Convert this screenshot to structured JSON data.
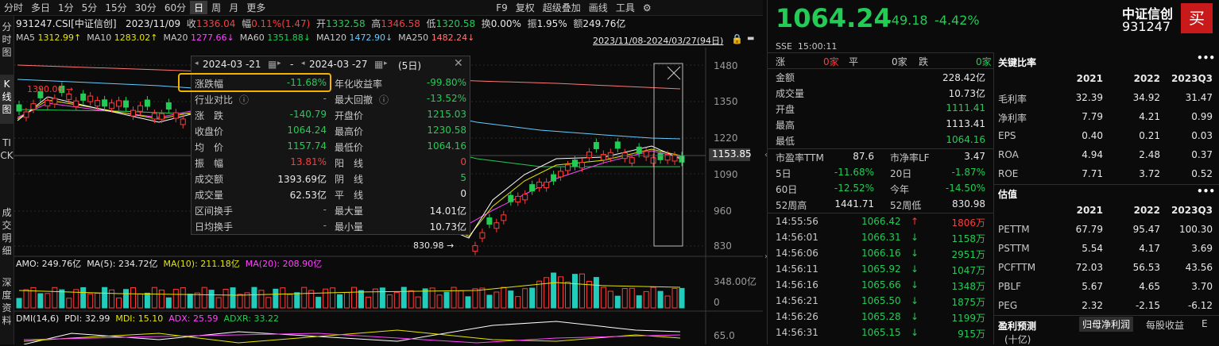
{
  "toolbar": {
    "tabs": [
      "分时",
      "多日",
      "1分",
      "5分",
      "15分",
      "30分",
      "60分",
      "日",
      "周",
      "月",
      "更多"
    ],
    "f9": "F9",
    "items": [
      "复权",
      "超级叠加",
      "画线",
      "工具"
    ]
  },
  "sidebar": {
    "items": [
      "分时图",
      "K线图",
      "TICK",
      "成交明细",
      "深度资料"
    ]
  },
  "header": {
    "symbol": "931247.CSI[中证信创]",
    "date": "2023/11/09",
    "close_label": "收",
    "close": "1336.04",
    "change_label": "幅",
    "change": "0.11%(1.47)",
    "open_label": "开",
    "open": "1332.58",
    "high_label": "高",
    "high": "1346.58",
    "low_label": "低",
    "low": "1320.58",
    "turnover_label": "换",
    "turnover": "0.00%",
    "amplitude_label": "振",
    "amplitude": "1.95%",
    "amount_label": "额",
    "amount": "249.76亿"
  },
  "ma_line": {
    "items": [
      {
        "label": "MA5",
        "value": "1312.99↑",
        "color": "#e6e600"
      },
      {
        "label": "MA10",
        "value": "1283.02↑",
        "color": "#e6e600"
      },
      {
        "label": "MA20",
        "value": "1277.66↓",
        "color": "#ff44ff"
      },
      {
        "label": "MA60",
        "value": "1351.88↓",
        "color": "#22cc55"
      },
      {
        "label": "MA120",
        "value": "1472.90↓",
        "color": "#66ccff"
      },
      {
        "label": "MA250",
        "value": "1482.24↓",
        "color": "#ff7777"
      }
    ],
    "range": "2023/11/08-2024/03/27(94日)"
  },
  "price_axis": {
    "ticks": [
      "1480",
      "1350",
      "1220",
      "1090",
      "960",
      "830"
    ],
    "current": "1153.85"
  },
  "annotations": {
    "high_mark": "1390.06",
    "low_mark": "830.98"
  },
  "popup": {
    "date_from": "2024-03 -21",
    "date_to": "2024-03 -27",
    "dash": "-",
    "days": "(5日)",
    "rows": [
      {
        "l1": "涨跌幅",
        "v1": "-11.68%",
        "c1": "green",
        "l2": "年化收益率",
        "v2": "-99.80%",
        "c2": "green"
      },
      {
        "l1": "行业对比",
        "v1": "-",
        "c1": "gray",
        "l2": "最大回撤",
        "v2": "-13.52%",
        "c2": "green"
      },
      {
        "l1": "涨　跌",
        "v1": "-140.79",
        "c1": "green",
        "l2": "开盘价",
        "v2": "1215.03",
        "c2": "green"
      },
      {
        "l1": "收盘价",
        "v1": "1064.24",
        "c1": "green",
        "l2": "最高价",
        "v2": "1230.58",
        "c2": "green"
      },
      {
        "l1": "均　价",
        "v1": "1157.74",
        "c1": "green",
        "l2": "最低价",
        "v2": "1064.16",
        "c2": "green"
      },
      {
        "l1": "振　幅",
        "v1": "13.81%",
        "c1": "red",
        "l2": "阳　线",
        "v2": "0",
        "c2": "red"
      },
      {
        "l1": "成交额",
        "v1": "1393.69亿",
        "c1": "white",
        "l2": "阴　线",
        "v2": "5",
        "c2": "green"
      },
      {
        "l1": "成交量",
        "v1": "62.53亿",
        "c1": "white",
        "l2": "平　线",
        "v2": "0",
        "c2": "white"
      },
      {
        "l1": "区间换手",
        "v1": "-",
        "c1": "gray",
        "l2": "最大量",
        "v2": "14.01亿",
        "c2": "white"
      },
      {
        "l1": "日均换手",
        "v1": "-",
        "c1": "gray",
        "l2": "最小量",
        "v2": "10.73亿",
        "c2": "white"
      }
    ]
  },
  "amo": {
    "items": [
      {
        "label": "AMO: 249.76亿",
        "color": "#e8e8e8"
      },
      {
        "label": "MA(5): 234.72亿",
        "color": "#e8e8e8"
      },
      {
        "label": "MA(10): 211.18亿",
        "color": "#e6e600"
      },
      {
        "label": "MA(20): 208.90亿",
        "color": "#ff44ff"
      }
    ],
    "axis_top": "348.00亿",
    "axis_zero": "0"
  },
  "dmi": {
    "items": [
      {
        "label": "DMI(14,6)",
        "color": "#e8e8e8"
      },
      {
        "label": "PDI: 32.99",
        "color": "#e8e8e8"
      },
      {
        "label": "MDI: 15.10",
        "color": "#e6e600"
      },
      {
        "label": "ADX: 25.59",
        "color": "#ff44ff"
      },
      {
        "label": "ADXR: 33.22",
        "color": "#22cc55"
      }
    ],
    "axis_top": "65.0"
  },
  "quote": {
    "price": "1064.24",
    "change": "-49.18",
    "change_pct": "-4.42%",
    "name": "中证信创",
    "code": "931247",
    "buy": "买",
    "exchange": "SSE",
    "time": "15:00:11",
    "breadth": {
      "up_label": "涨",
      "up": "0家",
      "flat_label": "平",
      "flat": "0家",
      "down_label": "跌",
      "down": "0家"
    },
    "stats": [
      {
        "label": "金额",
        "value": "228.42亿",
        "color": "white"
      },
      {
        "label": "成交量",
        "value": "10.73亿",
        "color": "white"
      },
      {
        "label": "开盘",
        "value": "1111.41",
        "color": "green"
      },
      {
        "label": "最高",
        "value": "1113.41",
        "color": "white"
      },
      {
        "label": "最低",
        "value": "1064.16",
        "color": "green"
      }
    ],
    "stats2": [
      {
        "l1": "市盈率TTM",
        "v1": "87.6",
        "c1": "white",
        "l2": "市净率LF",
        "v2": "3.47",
        "c2": "white"
      },
      {
        "l1": "5日",
        "v1": "-11.68%",
        "c1": "green",
        "l2": "20日",
        "v2": "-1.87%",
        "c2": "green"
      },
      {
        "l1": "60日",
        "v1": "-12.52%",
        "c1": "green",
        "l2": "今年",
        "v2": "-14.50%",
        "c2": "green"
      },
      {
        "l1": "52周高",
        "v1": "1441.71",
        "c1": "white",
        "l2": "52周低",
        "v2": "830.98",
        "c2": "white"
      }
    ],
    "ticks": [
      {
        "time": "14:55:56",
        "price": "1066.42",
        "arrow": "↑",
        "vol": "1806万",
        "pc": "green",
        "ac": "red"
      },
      {
        "time": "14:56:01",
        "price": "1066.31",
        "arrow": "↓",
        "vol": "1158万",
        "pc": "green",
        "ac": "green"
      },
      {
        "time": "14:56:06",
        "price": "1066.16",
        "arrow": "↓",
        "vol": "2951万",
        "pc": "green",
        "ac": "green"
      },
      {
        "time": "14:56:11",
        "price": "1065.92",
        "arrow": "↓",
        "vol": "1047万",
        "pc": "green",
        "ac": "green"
      },
      {
        "time": "14:56:16",
        "price": "1065.66",
        "arrow": "↓",
        "vol": "1348万",
        "pc": "green",
        "ac": "green"
      },
      {
        "time": "14:56:21",
        "price": "1065.50",
        "arrow": "↓",
        "vol": "1875万",
        "pc": "green",
        "ac": "green"
      },
      {
        "time": "14:56:26",
        "price": "1065.28",
        "arrow": "↓",
        "vol": "1199万",
        "pc": "green",
        "ac": "green"
      },
      {
        "time": "14:56:31",
        "price": "1065.15",
        "arrow": "↓",
        "vol": "915万",
        "pc": "green",
        "ac": "green"
      }
    ]
  },
  "ratios": {
    "title": "关键比率",
    "years": [
      "2021",
      "2022",
      "2023Q3"
    ],
    "rows": [
      {
        "label": "毛利率",
        "vals": [
          "32.39",
          "34.92",
          "31.47"
        ]
      },
      {
        "label": "净利率",
        "vals": [
          "7.79",
          "4.21",
          "0.99"
        ]
      },
      {
        "label": "EPS",
        "vals": [
          "0.40",
          "0.21",
          "0.03"
        ]
      },
      {
        "label": "ROA",
        "vals": [
          "4.94",
          "2.48",
          "0.37"
        ]
      },
      {
        "label": "ROE",
        "vals": [
          "7.71",
          "3.72",
          "0.52"
        ]
      }
    ]
  },
  "valuation": {
    "title": "估值",
    "years": [
      "2021",
      "2022",
      "2023Q3"
    ],
    "rows": [
      {
        "label": "PETTM",
        "vals": [
          "67.79",
          "95.47",
          "100.30"
        ]
      },
      {
        "label": "PSTTM",
        "vals": [
          "5.54",
          "4.17",
          "3.69"
        ]
      },
      {
        "label": "PCFTTM",
        "vals": [
          "72.03",
          "56.53",
          "43.56"
        ]
      },
      {
        "label": "PBLF",
        "vals": [
          "5.67",
          "4.65",
          "3.70"
        ]
      },
      {
        "label": "PEG",
        "vals": [
          "2.32",
          "-2.15",
          "-6.12"
        ]
      }
    ]
  },
  "forecast": {
    "title": "盈利预测",
    "tabs": [
      "归母净利润",
      "每股收益",
      "E"
    ],
    "unit": "(十亿)"
  },
  "colors": {
    "up": "#ff3b3b",
    "down": "#22cc55",
    "ma5": "#e6e600",
    "ma10": "#e6e600",
    "ma20": "#ff44ff",
    "ma60": "#22cc55",
    "ma120": "#66ccff",
    "ma250": "#ff7777",
    "highlight": "#f0b400"
  }
}
